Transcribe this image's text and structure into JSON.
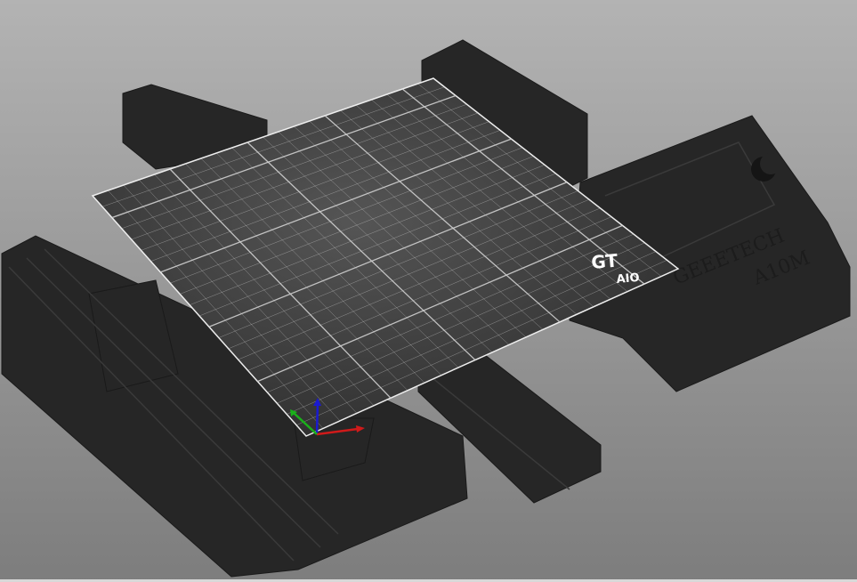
{
  "scene": {
    "printer_model_label": "GEEETECH",
    "printer_model_number": "A10M",
    "bed_logo": "GT AIO",
    "bed": {
      "size_x_mm": 220,
      "size_y_mm": 220,
      "grid_step_mm": 10,
      "major_step_mm": 50
    },
    "colors": {
      "background_top": "#b3b3b3",
      "background_bottom": "#7d7d7d",
      "printer_body": "#2b2b2b",
      "bed_surface": "#3c3c3c",
      "grid": "#d0d0d0",
      "axis_x": "#c01010",
      "axis_y": "#10a010",
      "axis_z": "#1010c0"
    }
  }
}
